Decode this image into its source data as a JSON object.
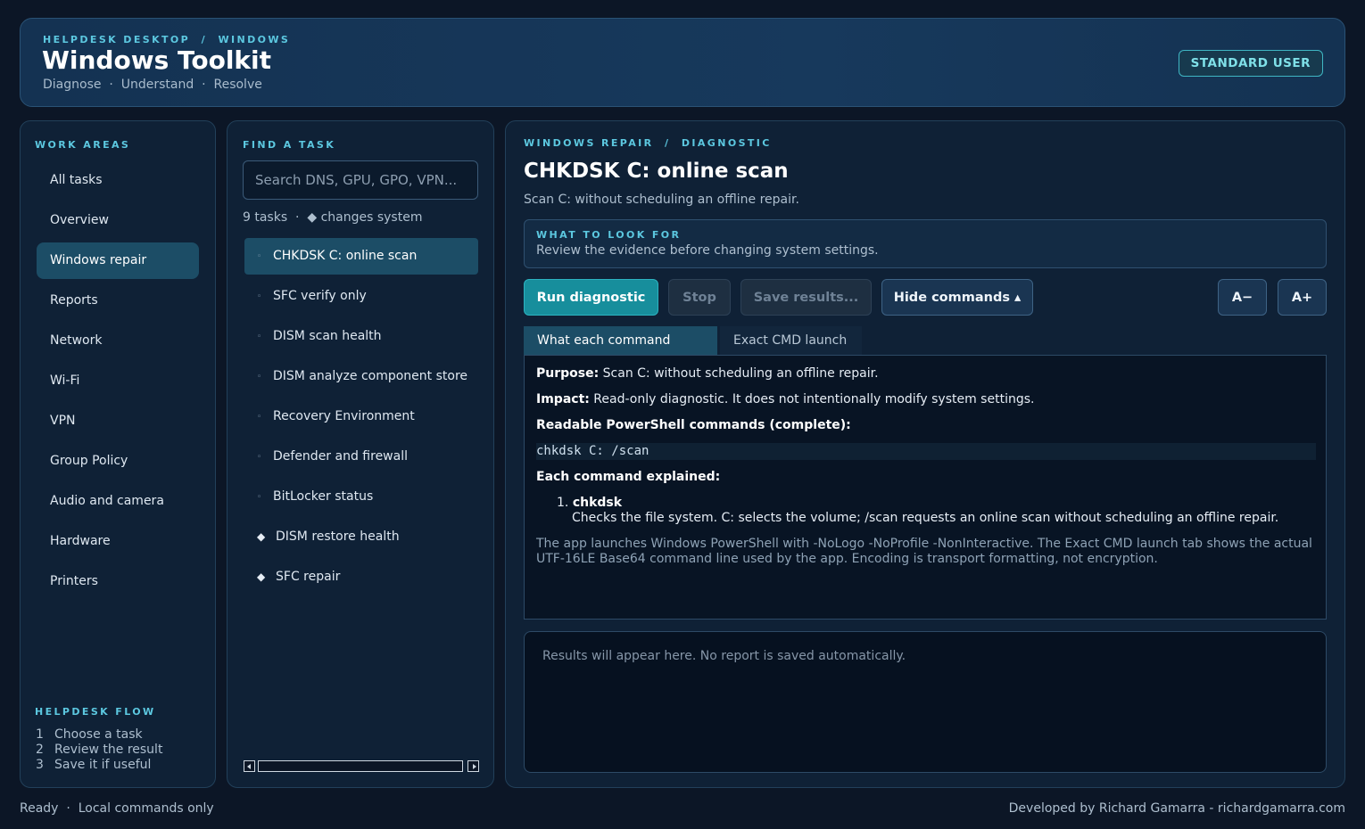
{
  "header": {
    "eyebrow": "HELPDESK DESKTOP  /  WINDOWS",
    "title": "Windows Toolkit",
    "subtitle": "Diagnose  ·  Understand  ·  Resolve",
    "role_badge": "STANDARD USER"
  },
  "sidebar": {
    "title": "WORK AREAS",
    "items": [
      {
        "label": "All tasks",
        "active": false
      },
      {
        "label": "Overview",
        "active": false
      },
      {
        "label": "Windows repair",
        "active": true
      },
      {
        "label": "Reports",
        "active": false
      },
      {
        "label": "Network",
        "active": false
      },
      {
        "label": "Wi-Fi",
        "active": false
      },
      {
        "label": "VPN",
        "active": false
      },
      {
        "label": "Group Policy",
        "active": false
      },
      {
        "label": "Audio and camera",
        "active": false
      },
      {
        "label": "Hardware",
        "active": false
      },
      {
        "label": "Printers",
        "active": false
      }
    ],
    "flow_title": "HELPDESK FLOW",
    "flow_steps": [
      {
        "num": "1",
        "label": "Choose a task"
      },
      {
        "num": "2",
        "label": "Review the result"
      },
      {
        "num": "3",
        "label": "Save it if useful"
      }
    ]
  },
  "tasks": {
    "title": "FIND A TASK",
    "search_placeholder": "Search DNS, GPU, GPO, VPN...",
    "meta": "9 tasks  ·  ◆ changes system",
    "items": [
      {
        "label": "CHKDSK C: online scan",
        "marker": "◦",
        "changes_system": false,
        "active": true
      },
      {
        "label": "SFC verify only",
        "marker": "◦",
        "changes_system": false,
        "active": false
      },
      {
        "label": "DISM scan health",
        "marker": "◦",
        "changes_system": false,
        "active": false
      },
      {
        "label": "DISM analyze component store",
        "marker": "◦",
        "changes_system": false,
        "active": false
      },
      {
        "label": "Recovery Environment",
        "marker": "◦",
        "changes_system": false,
        "active": false
      },
      {
        "label": "Defender and firewall",
        "marker": "◦",
        "changes_system": false,
        "active": false
      },
      {
        "label": "BitLocker status",
        "marker": "◦",
        "changes_system": false,
        "active": false
      },
      {
        "label": "DISM restore health",
        "marker": "◆",
        "changes_system": true,
        "active": false
      },
      {
        "label": "SFC repair",
        "marker": "◆",
        "changes_system": true,
        "active": false
      }
    ]
  },
  "main": {
    "eyebrow": "WINDOWS REPAIR  /  DIAGNOSTIC",
    "title": "CHKDSK C: online scan",
    "description": "Scan C: without scheduling an offline repair.",
    "look_for": {
      "title": "WHAT TO LOOK FOR",
      "text": "Review the evidence before changing system settings."
    },
    "buttons": {
      "run": "Run diagnostic",
      "stop": "Stop",
      "save": "Save results...",
      "hide": "Hide commands ▴",
      "font_smaller": "A−",
      "font_larger": "A+"
    },
    "tabs": [
      {
        "label": "What each command does",
        "active": true
      },
      {
        "label": "Exact CMD launch",
        "active": false
      }
    ],
    "doc": {
      "purpose_label": "Purpose:",
      "purpose_text": " Scan C: without scheduling an offline repair.",
      "impact_label": "Impact:",
      "impact_text": " Read-only diagnostic. It does not intentionally modify system settings.",
      "commands_heading": "Readable PowerShell commands (complete):",
      "code": "chkdsk C: /scan",
      "explained_heading": "Each command explained:",
      "commands": [
        {
          "num": "1.",
          "name": "chkdsk",
          "explanation": "Checks the file system. C: selects the volume; /scan requests an online scan without scheduling an offline repair."
        }
      ],
      "note": "The app launches Windows PowerShell with -NoLogo -NoProfile -NonInteractive. The Exact CMD launch tab shows the actual UTF-16LE Base64 command line used by the app. Encoding is transport formatting, not encryption."
    },
    "results_placeholder": "Results will appear here. No report is saved automatically."
  },
  "footer": {
    "status": "Ready  ·  Local commands only",
    "credit": "Developed by Richard Gamarra - richardgamarra.com"
  },
  "colors": {
    "background": "#0c1626",
    "accent": "#5cc8e0",
    "active_item": "#1c4d66",
    "primary_button": "#178e9c"
  }
}
